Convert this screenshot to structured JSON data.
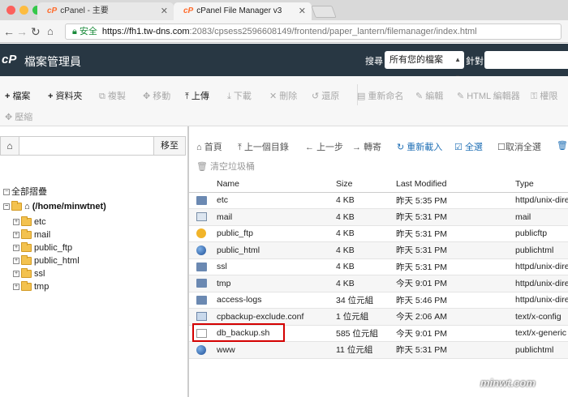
{
  "browser": {
    "tabs": [
      {
        "brand": "cP",
        "label": "cPanel - 主要"
      },
      {
        "brand": "cP",
        "label": "cPanel File Manager v3"
      }
    ],
    "secure_label": "安全",
    "url_host": "https://fh1.tw-dns.com",
    "url_rest": ":2083/cpsess2596608149/frontend/paper_lantern/filemanager/index.html",
    "dot_colors": [
      "#fc605c",
      "#fdbc40",
      "#34c84a"
    ]
  },
  "header": {
    "logo": "cP",
    "title": "檔案管理員",
    "search_label": "搜尋",
    "search_scope": "所有您的檔案",
    "for_label": "針對"
  },
  "toolbar": {
    "file": "檔案",
    "folder": "資料夾",
    "copy": "複製",
    "move": "移動",
    "upload": "上傳",
    "download": "下載",
    "delete": "刪除",
    "restore": "還原",
    "rename": "重新命名",
    "edit": "編輯",
    "html_editor": "HTML 編輯器",
    "permissions": "權限",
    "compress": "壓縮"
  },
  "left": {
    "go_label": "移至",
    "collapse_all": "全部摺疊",
    "root": "(/home/minwtnet)",
    "tree": [
      "etc",
      "mail",
      "public_ftp",
      "public_html",
      "ssl",
      "tmp"
    ]
  },
  "nav": {
    "home": "首頁",
    "up": "上一個目錄",
    "back": "上一步",
    "forward": "轉寄",
    "reload": "重新載入",
    "select_all": "全選",
    "deselect_all": "取消全選",
    "empty_trash": "清空垃圾桶"
  },
  "table": {
    "columns": [
      "Name",
      "Size",
      "Last Modified",
      "Type"
    ],
    "rows": [
      {
        "icon": "folder-icon",
        "name": "etc",
        "size": "4 KB",
        "modified": "昨天 5:35 PM",
        "type": "httpd/unix-dire"
      },
      {
        "icon": "mail-icon",
        "name": "mail",
        "size": "4 KB",
        "modified": "昨天 5:31 PM",
        "type": "mail"
      },
      {
        "icon": "ftp-icon",
        "name": "public_ftp",
        "size": "4 KB",
        "modified": "昨天 5:31 PM",
        "type": "publicftp"
      },
      {
        "icon": "globe-icon",
        "name": "public_html",
        "size": "4 KB",
        "modified": "昨天 5:31 PM",
        "type": "publichtml"
      },
      {
        "icon": "folder-icon",
        "name": "ssl",
        "size": "4 KB",
        "modified": "昨天 5:31 PM",
        "type": "httpd/unix-dire"
      },
      {
        "icon": "folder-icon",
        "name": "tmp",
        "size": "4 KB",
        "modified": "今天 9:01 PM",
        "type": "httpd/unix-dire"
      },
      {
        "icon": "folder-icon",
        "name": "access-logs",
        "size": "34 位元組",
        "modified": "昨天 5:46 PM",
        "type": "httpd/unix-dire"
      },
      {
        "icon": "config-file-icon",
        "name": "cpbackup-exclude.conf",
        "size": "1 位元組",
        "modified": "今天 2:06 AM",
        "type": "text/x-config"
      },
      {
        "icon": "script-file-icon",
        "name": "db_backup.sh",
        "size": "585 位元組",
        "modified": "今天 9:01 PM",
        "type": "text/x-generic"
      },
      {
        "icon": "globe-icon",
        "name": "www",
        "size": "11 位元組",
        "modified": "昨天 5:31 PM",
        "type": "publichtml"
      }
    ]
  },
  "watermark": "minwt.com"
}
